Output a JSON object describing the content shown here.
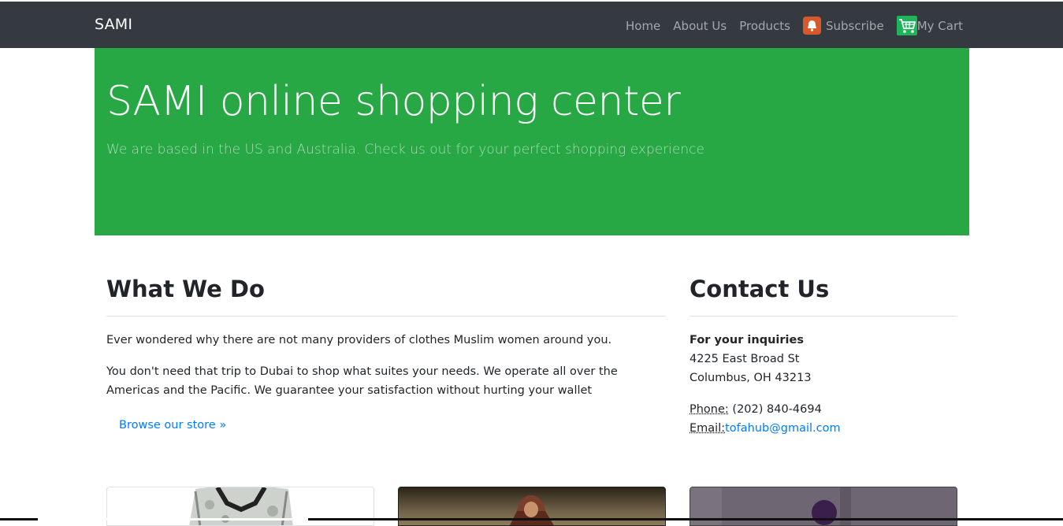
{
  "navbar": {
    "brand": "SAMI",
    "items": [
      {
        "label": "Home"
      },
      {
        "label": "About Us"
      },
      {
        "label": "Products"
      },
      {
        "label": "Subscribe",
        "icon": "bell-icon"
      },
      {
        "label": "My Cart",
        "icon": "cart-icon"
      }
    ]
  },
  "jumbotron": {
    "title": "SAMI online shopping center",
    "lead": "We are based in the US and Australia. Check us out for your perfect shopping experience"
  },
  "what_we_do": {
    "heading": "What We Do",
    "p1": "Ever wondered why there are not many providers of clothes Muslim women around you.",
    "p2": "You don't need that trip to Dubai to shop what suites your needs. We operate all over the Americas and the Pacific. We guarantee your satisfaction without hurting your wallet",
    "button": "Browse our store »"
  },
  "contact": {
    "heading": "Contact Us",
    "inquiries": "For your inquiries",
    "street": "4225 East Broad St",
    "city": "Columbus, OH 43213",
    "phone_label": "Phone:",
    "phone": " (202) 840-4694",
    "email_label": "Email:",
    "email": "tofahub@gmail.com"
  },
  "colors": {
    "navbar": "#343a40",
    "jumbotron": "#28a745",
    "link": "#007bff"
  }
}
